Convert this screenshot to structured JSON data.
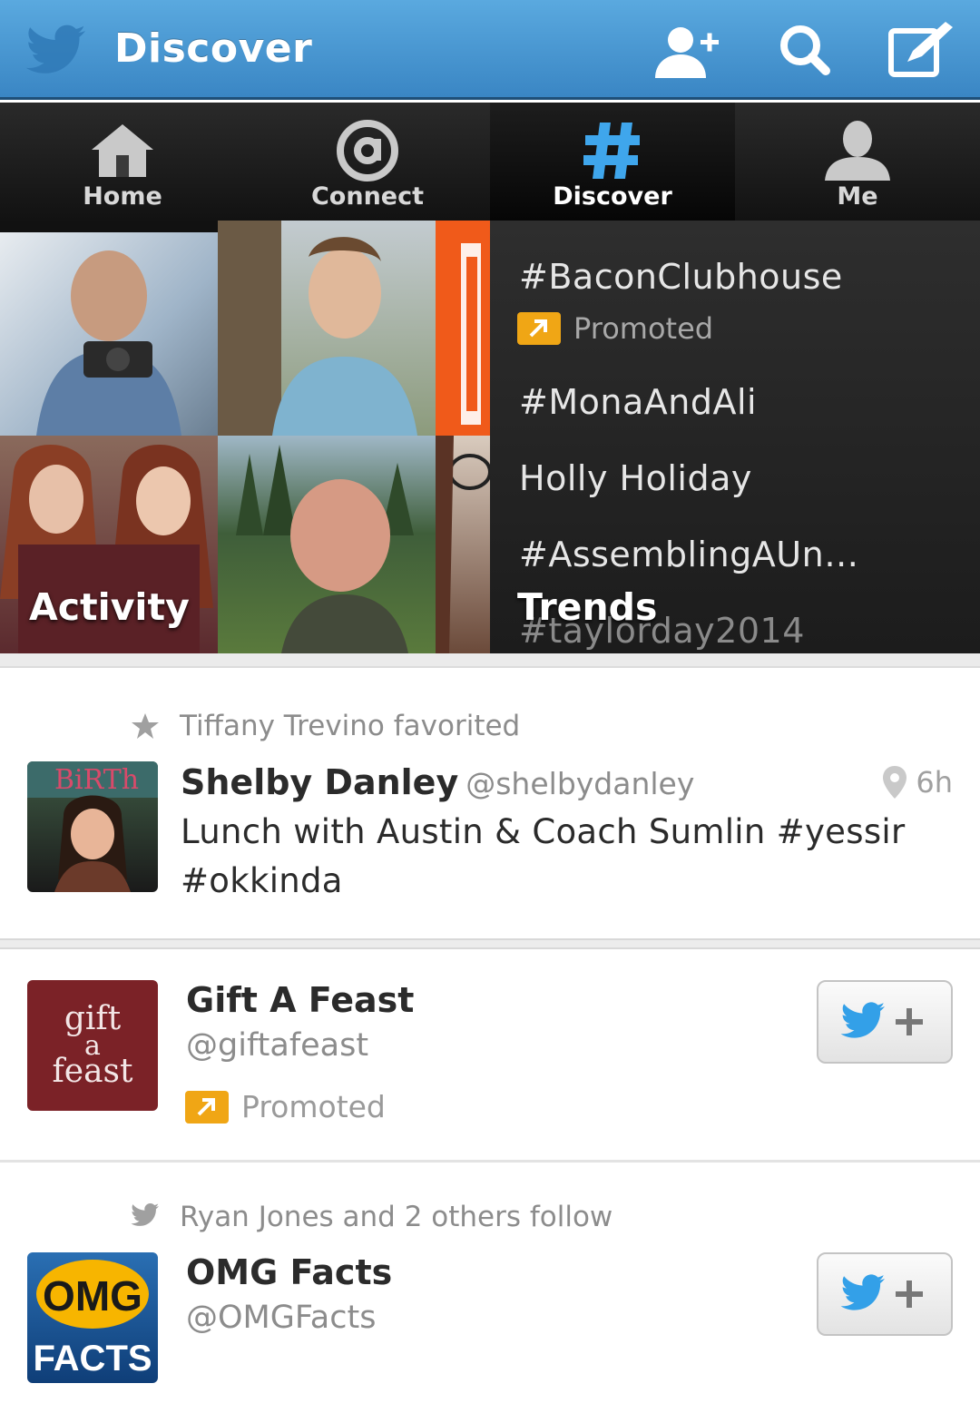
{
  "header": {
    "title": "Discover",
    "accent": "#4a9ad6"
  },
  "tabs": [
    {
      "label": "Home",
      "icon": "home-icon",
      "active": false
    },
    {
      "label": "Connect",
      "icon": "at-icon",
      "active": false
    },
    {
      "label": "Discover",
      "icon": "hashtag-icon",
      "active": true
    },
    {
      "label": "Me",
      "icon": "person-icon",
      "active": false
    }
  ],
  "activity": {
    "label": "Activity"
  },
  "trends": {
    "label": "Trends",
    "items": [
      {
        "text": "#BaconClubhouse"
      },
      {
        "text": "#MonaAndAli"
      },
      {
        "text": "Holly Holiday"
      },
      {
        "text": "#AssemblingAUn…"
      },
      {
        "text": "#taylorday2014"
      }
    ],
    "promoted_label": "Promoted"
  },
  "feed": {
    "tweet": {
      "context": "Tiffany Trevino favorited",
      "name": "Shelby Danley",
      "handle": "@shelbydanley",
      "time": "6h",
      "text": "Lunch with Austin & Coach Sumlin #yessir #okkinda"
    },
    "account1": {
      "name": "Gift A Feast",
      "handle": "@giftafeast",
      "promoted_label": "Promoted",
      "logo_text": [
        "gift",
        "a",
        "feast"
      ]
    },
    "account2": {
      "context": "Ryan Jones and 2 others follow",
      "name": "OMG Facts",
      "handle": "@OMGFacts",
      "logo_text": [
        "OMG",
        "FACTS"
      ]
    }
  },
  "colors": {
    "promoted": "#f0a615",
    "twitter_blue": "#33a0e8"
  }
}
